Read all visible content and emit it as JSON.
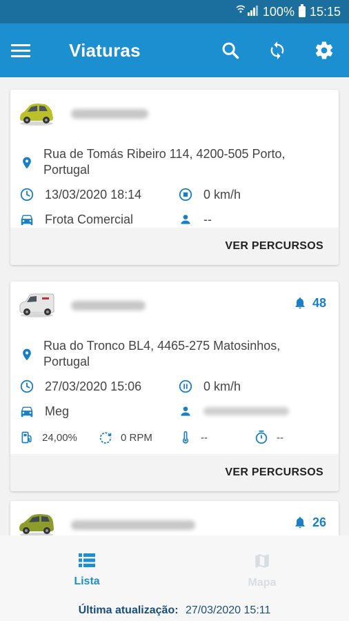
{
  "status_bar": {
    "signal": "",
    "battery_pct": "100%",
    "time": "15:15"
  },
  "app_bar": {
    "title": "Viaturas"
  },
  "vehicles": [
    {
      "address": "Rua de Tomás Ribeiro 114, 4200-505 Porto, Portugal",
      "datetime": "13/03/2020 18:14",
      "speed": "0 km/h",
      "group": "Frota Comercial",
      "driver": "--",
      "action": "VER PERCURSOS",
      "car_color": "#b9c02a"
    },
    {
      "alerts": "48",
      "address": "Rua do Tronco BL4, 4465-275 Matosinhos, Portugal",
      "datetime": "27/03/2020 15:06",
      "speed": "0 km/h",
      "group": "Meg",
      "fuel": "24,00%",
      "rpm": "0 RPM",
      "temp": "--",
      "timer": "--",
      "action": "VER PERCURSOS",
      "car_color": "#e6e6e6"
    },
    {
      "alerts": "26",
      "car_color": "#8e9c2c"
    }
  ],
  "bottom_nav": {
    "tabs": [
      {
        "label": "Lista",
        "icon": "list-icon",
        "active": true
      },
      {
        "label": "Mapa",
        "icon": "map-icon",
        "active": false
      }
    ],
    "last_update_label": "Última atualização:",
    "last_update_value": "27/03/2020 15:11"
  },
  "colors": {
    "primary": "#1c8fd1",
    "status_bar": "#1a6f9e",
    "icon_blue": "#1a7fc4"
  }
}
